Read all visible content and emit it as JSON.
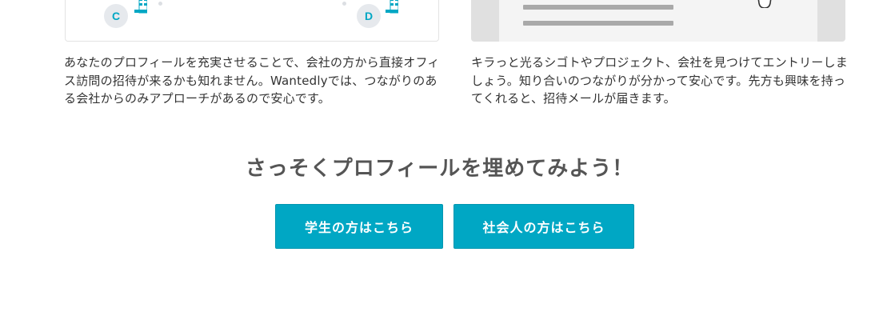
{
  "left_card": {
    "badge_c": "C",
    "badge_d": "D",
    "description": "あなたのプロフィールを充実させることで、会社の方から直接オフィス訪問の招待が来るかも知れません。Wantedlyでは、つながりのある会社からのみアプローチがあるので安心です。"
  },
  "right_card": {
    "description": "キラっと光るシゴトやプロジェクト、会社を見つけてエントリーしましょう。知り合いのつながりが分かって安心です。先方も興味を持ってくれると、招待メールが届きます。"
  },
  "cta": {
    "heading": "さっそくプロフィールを埋めてみよう！",
    "student_button": "学生の方はこちら",
    "worker_button": "社会人の方はこちら"
  },
  "colors": {
    "accent": "#00a7c4",
    "badge_bg": "#e6e9ed",
    "text": "#333333"
  }
}
